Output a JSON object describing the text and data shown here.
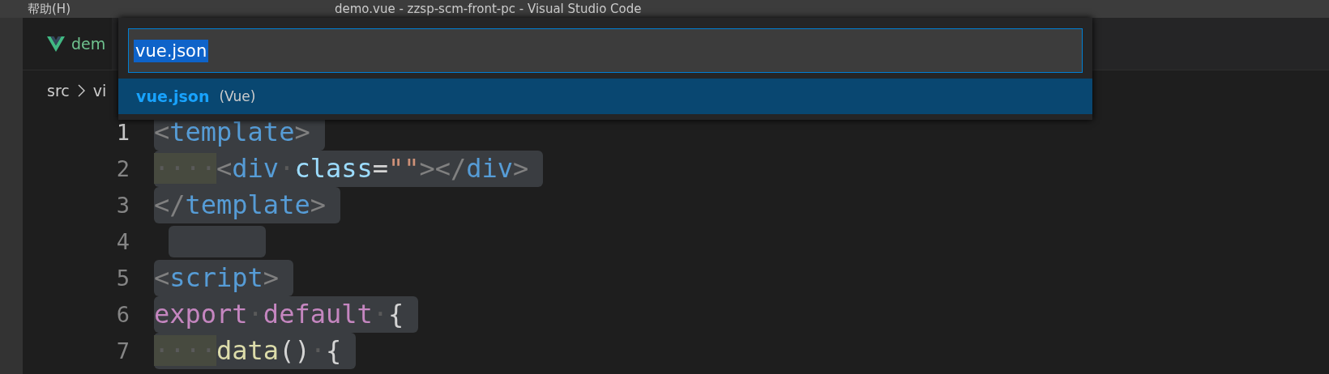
{
  "title_bar": {
    "menu_item": "帮助(H)",
    "title": "demo.vue - zzsp-scm-front-pc - Visual Studio Code"
  },
  "tab": {
    "label": "dem"
  },
  "breadcrumb": [
    "src",
    "vi"
  ],
  "quick_pick": {
    "value": "vue.json",
    "value_selected": true,
    "items": [
      {
        "label": "vue.json",
        "description": "(Vue)",
        "selected": true
      }
    ]
  },
  "editor": {
    "lines": [
      {
        "number": "1",
        "active": true,
        "tokens": [
          {
            "text": "<",
            "kind": "punct"
          },
          {
            "text": "template",
            "kind": "tag"
          },
          {
            "text": ">",
            "kind": "punct"
          }
        ]
      },
      {
        "number": "2",
        "active": false,
        "tokens": [
          {
            "text": "····",
            "kind": "indent"
          },
          {
            "text": "<",
            "kind": "punct"
          },
          {
            "text": "div",
            "kind": "tag"
          },
          {
            "text": "·",
            "kind": "space"
          },
          {
            "text": "class",
            "kind": "attr"
          },
          {
            "text": "=",
            "kind": "plain"
          },
          {
            "text": "\"\"",
            "kind": "string"
          },
          {
            "text": "></",
            "kind": "punct"
          },
          {
            "text": "div",
            "kind": "tag"
          },
          {
            "text": ">",
            "kind": "punct"
          }
        ]
      },
      {
        "number": "3",
        "active": false,
        "tokens": [
          {
            "text": "</",
            "kind": "punct"
          },
          {
            "text": "template",
            "kind": "tag"
          },
          {
            "text": ">",
            "kind": "punct"
          }
        ]
      },
      {
        "number": "4",
        "active": false
      },
      {
        "number": "5",
        "active": false,
        "tokens": [
          {
            "text": "<",
            "kind": "punct"
          },
          {
            "text": "script",
            "kind": "tag"
          },
          {
            "text": ">",
            "kind": "punct"
          }
        ]
      },
      {
        "number": "6",
        "active": false,
        "tokens": [
          {
            "text": "export",
            "kind": "keyword"
          },
          {
            "text": "·",
            "kind": "space"
          },
          {
            "text": "default",
            "kind": "keyword"
          },
          {
            "text": "·",
            "kind": "space"
          },
          {
            "text": "{",
            "kind": "plain"
          }
        ]
      },
      {
        "number": "7",
        "active": false,
        "tokens": [
          {
            "text": "····",
            "kind": "indent"
          },
          {
            "text": "data",
            "kind": "func"
          },
          {
            "text": "()",
            "kind": "plain"
          },
          {
            "text": "·",
            "kind": "space"
          },
          {
            "text": "{",
            "kind": "plain"
          }
        ]
      }
    ]
  }
}
